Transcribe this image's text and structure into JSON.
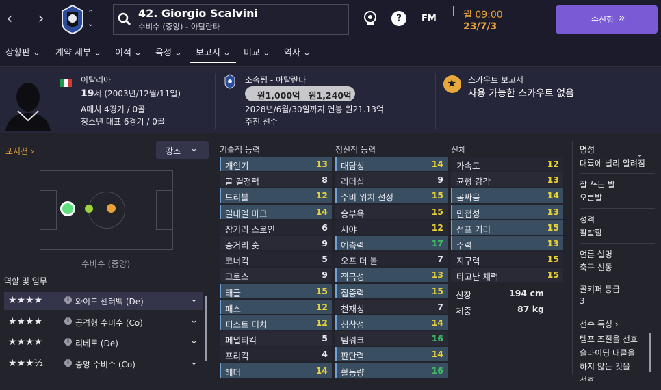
{
  "header": {
    "player_name": "42. Giorgio Scalvini",
    "player_subtitle": "수비수 (중앙) - 아탈란타",
    "manager_icon": "FM",
    "date_day": "월 09:00",
    "date": "23/7/3",
    "continue_label": "수신함",
    "continue_icon": "»"
  },
  "tabs": [
    "상황판",
    "계약 세부",
    "이적",
    "육성",
    "보고서",
    "비교",
    "역사"
  ],
  "active_tab": "보고서",
  "info": {
    "nationality": "이탈리아",
    "age": "19",
    "age_suffix": "세",
    "birth": "(2003년/12월/11일)",
    "caps": "A매치 4경기 / 0골",
    "youth": "청소년 대표 6경기 / 0골",
    "club": "소속팀 - 아탈란타",
    "value_low": "원1,000억",
    "value_high": "원1,240억",
    "value_sep": " - ",
    "contract": "2028년/6월/30일까지 연봉 원21.13억",
    "squad_status": "주전 선수",
    "scout_title": "스카우트 보고서",
    "scout_text": "사용 가능한 스카우트 없음"
  },
  "left": {
    "position_label": "포지션",
    "highlight_label": "강조",
    "position_text": "수비수 (중앙)",
    "roles_title": "역할 및 임무"
  },
  "roles": [
    {
      "stars": "★★★★",
      "label": "와이드 센터백 (De)"
    },
    {
      "stars": "★★★★",
      "label": "공격형 수비수 (Co)"
    },
    {
      "stars": "★★★★",
      "label": "리베로 (De)"
    },
    {
      "stars": "★★★½",
      "label": "중앙 수비수 (Co)"
    }
  ],
  "technical": {
    "title": "기술적 능력",
    "rows": [
      {
        "name": "개인기",
        "val": "13",
        "hl": true
      },
      {
        "name": "골 결정력",
        "val": "8",
        "hl": false
      },
      {
        "name": "드리블",
        "val": "12",
        "hl": true
      },
      {
        "name": "일대일 마크",
        "val": "14",
        "hl": true
      },
      {
        "name": "장거리 스로인",
        "val": "6",
        "hl": false
      },
      {
        "name": "중거리 슛",
        "val": "9",
        "hl": false
      },
      {
        "name": "코너킥",
        "val": "5",
        "hl": false
      },
      {
        "name": "크로스",
        "val": "9",
        "hl": false
      },
      {
        "name": "태클",
        "val": "15",
        "hl": true
      },
      {
        "name": "패스",
        "val": "12",
        "hl": true
      },
      {
        "name": "퍼스트 터치",
        "val": "12",
        "hl": true
      },
      {
        "name": "페널티킥",
        "val": "5",
        "hl": false
      },
      {
        "name": "프리킥",
        "val": "4",
        "hl": false
      },
      {
        "name": "헤더",
        "val": "14",
        "hl": true
      }
    ]
  },
  "mental": {
    "title": "정신적 능력",
    "rows": [
      {
        "name": "대담성",
        "val": "14",
        "hl": true
      },
      {
        "name": "리더십",
        "val": "9",
        "hl": false
      },
      {
        "name": "수비 위치 선정",
        "val": "15",
        "hl": true
      },
      {
        "name": "승부욕",
        "val": "15",
        "hl": false
      },
      {
        "name": "시야",
        "val": "12",
        "hl": false
      },
      {
        "name": "예측력",
        "val": "17",
        "hl": true
      },
      {
        "name": "오프 더 볼",
        "val": "7",
        "hl": false
      },
      {
        "name": "적극성",
        "val": "13",
        "hl": true
      },
      {
        "name": "집중력",
        "val": "15",
        "hl": true
      },
      {
        "name": "천재성",
        "val": "7",
        "hl": false
      },
      {
        "name": "침착성",
        "val": "14",
        "hl": true
      },
      {
        "name": "팀워크",
        "val": "16",
        "hl": false
      },
      {
        "name": "판단력",
        "val": "14",
        "hl": true
      },
      {
        "name": "활동량",
        "val": "16",
        "hl": true
      }
    ]
  },
  "physical": {
    "title": "신체",
    "rows": [
      {
        "name": "가속도",
        "val": "12",
        "hl": false
      },
      {
        "name": "균형 감각",
        "val": "13",
        "hl": false
      },
      {
        "name": "몸싸움",
        "val": "14",
        "hl": true
      },
      {
        "name": "민첩성",
        "val": "13",
        "hl": true
      },
      {
        "name": "점프 거리",
        "val": "15",
        "hl": true
      },
      {
        "name": "주력",
        "val": "13",
        "hl": true
      },
      {
        "name": "지구력",
        "val": "15",
        "hl": false
      },
      {
        "name": "타고난 체력",
        "val": "15",
        "hl": false
      }
    ],
    "height_label": "신장",
    "height": "194 cm",
    "weight_label": "체중",
    "weight": "87 kg"
  },
  "right": {
    "reputation_label": "명성",
    "reputation": "대륙에 널리 알려짐",
    "foot_label": "잘 쓰는 발",
    "foot": "오른발",
    "personality_label": "성격",
    "personality": "활발함",
    "media_label": "언론 설명",
    "media": "축구 신동",
    "gk_label": "골키퍼 등급",
    "gk": "3",
    "traits_label": "선수 특성",
    "traits": [
      "템포 조절을 선호",
      "슬라이딩 태클을",
      "하지 않는 것을",
      "선호"
    ]
  },
  "colors": {
    "green": "#3fbf62",
    "yellow": "#e8d13a",
    "accent": "#7b5ad6",
    "date": "#e8a13a"
  }
}
